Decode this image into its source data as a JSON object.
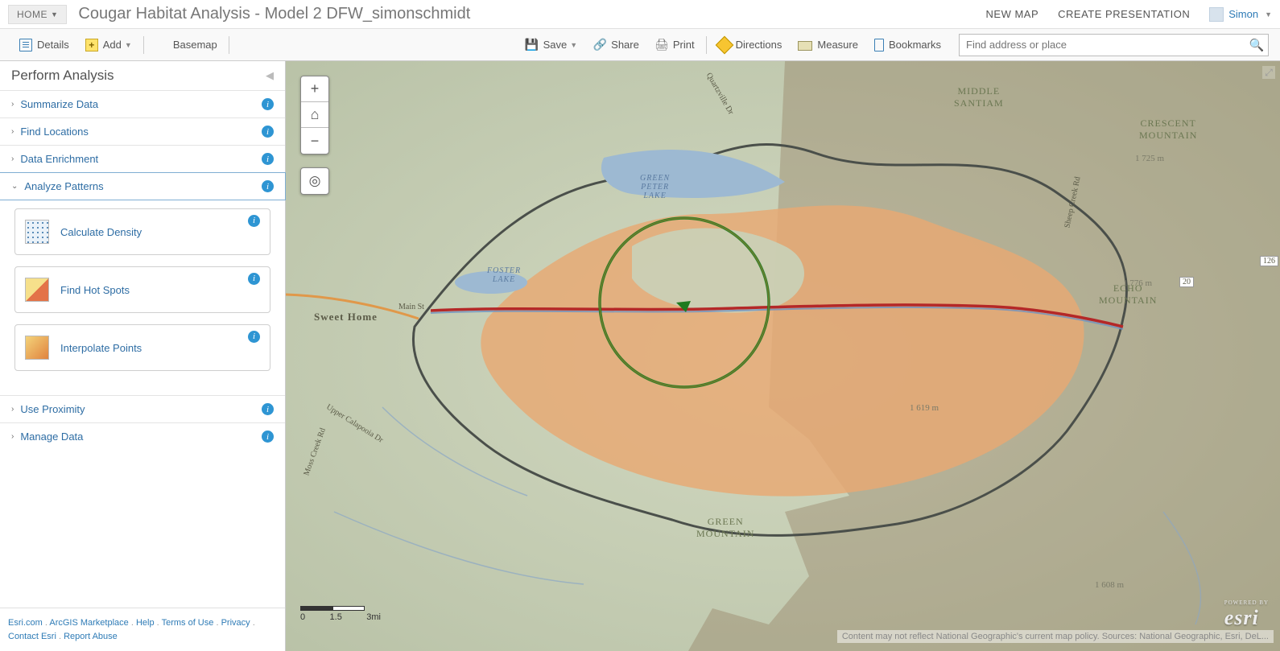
{
  "header": {
    "home": "HOME",
    "title": "Cougar Habitat Analysis - Model 2 DFW_simonschmidt",
    "new_map": "NEW MAP",
    "create_presentation": "CREATE PRESENTATION",
    "user": "Simon"
  },
  "toolbar": {
    "details": "Details",
    "add": "Add",
    "basemap": "Basemap",
    "save": "Save",
    "share": "Share",
    "print": "Print",
    "directions": "Directions",
    "measure": "Measure",
    "bookmarks": "Bookmarks",
    "search_placeholder": "Find address or place"
  },
  "panel": {
    "title": "Perform Analysis",
    "sections": {
      "summarize": "Summarize Data",
      "find_locations": "Find Locations",
      "data_enrichment": "Data Enrichment",
      "analyze_patterns": "Analyze Patterns",
      "use_proximity": "Use Proximity",
      "manage_data": "Manage Data"
    },
    "tools": {
      "density": "Calculate Density",
      "hotspots": "Find Hot Spots",
      "interpolate": "Interpolate Points"
    }
  },
  "map": {
    "city": "Sweet Home",
    "lakes": {
      "green_peter": "GREEN\nPETER\nLAKE",
      "foster": "FOSTER\nLAKE"
    },
    "mountains": {
      "middle_santiam": "MIDDLE\nSANTIAM",
      "crescent": "CRESCENT\nMOUNTAIN",
      "echo": "ECHO\nMOUNTAIN",
      "green": "GREEN\nMOUNTAIN"
    },
    "roads": {
      "main_st": "Main St",
      "upper_calapooia": "Upper Calapooia Dr",
      "quartzville": "Quartzville Dr",
      "sheep_creek": "Sheep Creek Rd",
      "moss_creek": "Moss Creek Rd"
    },
    "elev": {
      "e1725": "1 725 m",
      "e1776": "1 776 m",
      "e1619": "1 619 m",
      "e1608": "1 608 m"
    },
    "hwy": {
      "h20": "20",
      "h126": "126"
    },
    "scale": {
      "s0": "0",
      "s1": "1.5",
      "s2": "3mi"
    },
    "attribution": "Content may not reflect National Geographic's current map policy. Sources: National Geographic, Esri, DeL...",
    "esri": "esri",
    "esri_sub": "POWERED BY"
  },
  "footer": {
    "links": [
      "Esri.com",
      "ArcGIS Marketplace",
      "Help",
      "Terms of Use",
      "Privacy",
      "Contact Esri",
      "Report Abuse"
    ]
  }
}
